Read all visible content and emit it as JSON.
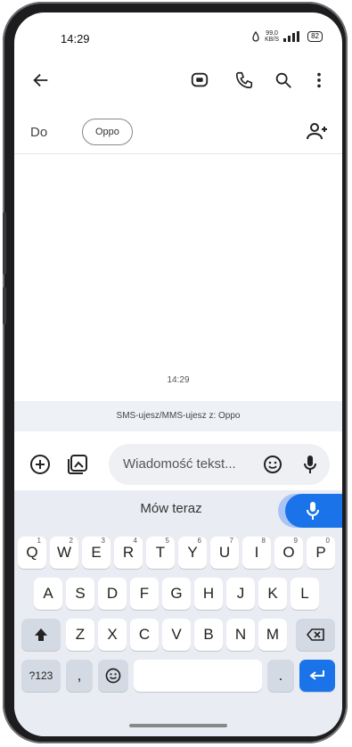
{
  "status_bar": {
    "time": "14:29",
    "net_rate_value": "99,0",
    "net_rate_unit": "KB/S",
    "battery": "82"
  },
  "app_bar": {
    "icons": [
      "back-arrow-icon",
      "video-message-icon",
      "phone-icon",
      "search-icon",
      "more-vert-icon"
    ]
  },
  "recipient": {
    "label": "Do",
    "chip": "Oppo"
  },
  "conversation": {
    "timestamp": "14:29",
    "sms_notice": "SMS-ujesz/MMS-ujesz z: Oppo"
  },
  "compose": {
    "placeholder": "Wiadomość tekst..."
  },
  "keyboard": {
    "voice_label": "Mów teraz",
    "row1": [
      {
        "k": "Q",
        "n": "1"
      },
      {
        "k": "W",
        "n": "2"
      },
      {
        "k": "E",
        "n": "3"
      },
      {
        "k": "R",
        "n": "4"
      },
      {
        "k": "T",
        "n": "5"
      },
      {
        "k": "Y",
        "n": "6"
      },
      {
        "k": "U",
        "n": "7"
      },
      {
        "k": "I",
        "n": "8"
      },
      {
        "k": "O",
        "n": "9"
      },
      {
        "k": "P",
        "n": "0"
      }
    ],
    "row2": [
      "A",
      "S",
      "D",
      "F",
      "G",
      "H",
      "J",
      "K",
      "L"
    ],
    "row3": [
      "Z",
      "X",
      "C",
      "V",
      "B",
      "N",
      "M"
    ],
    "symbols_label": "?123",
    "comma": ",",
    "period": "."
  },
  "colors": {
    "accent": "#1a73e8",
    "keyboard_bg": "#e9edf3",
    "sms_bar_bg": "#eef2f6"
  }
}
